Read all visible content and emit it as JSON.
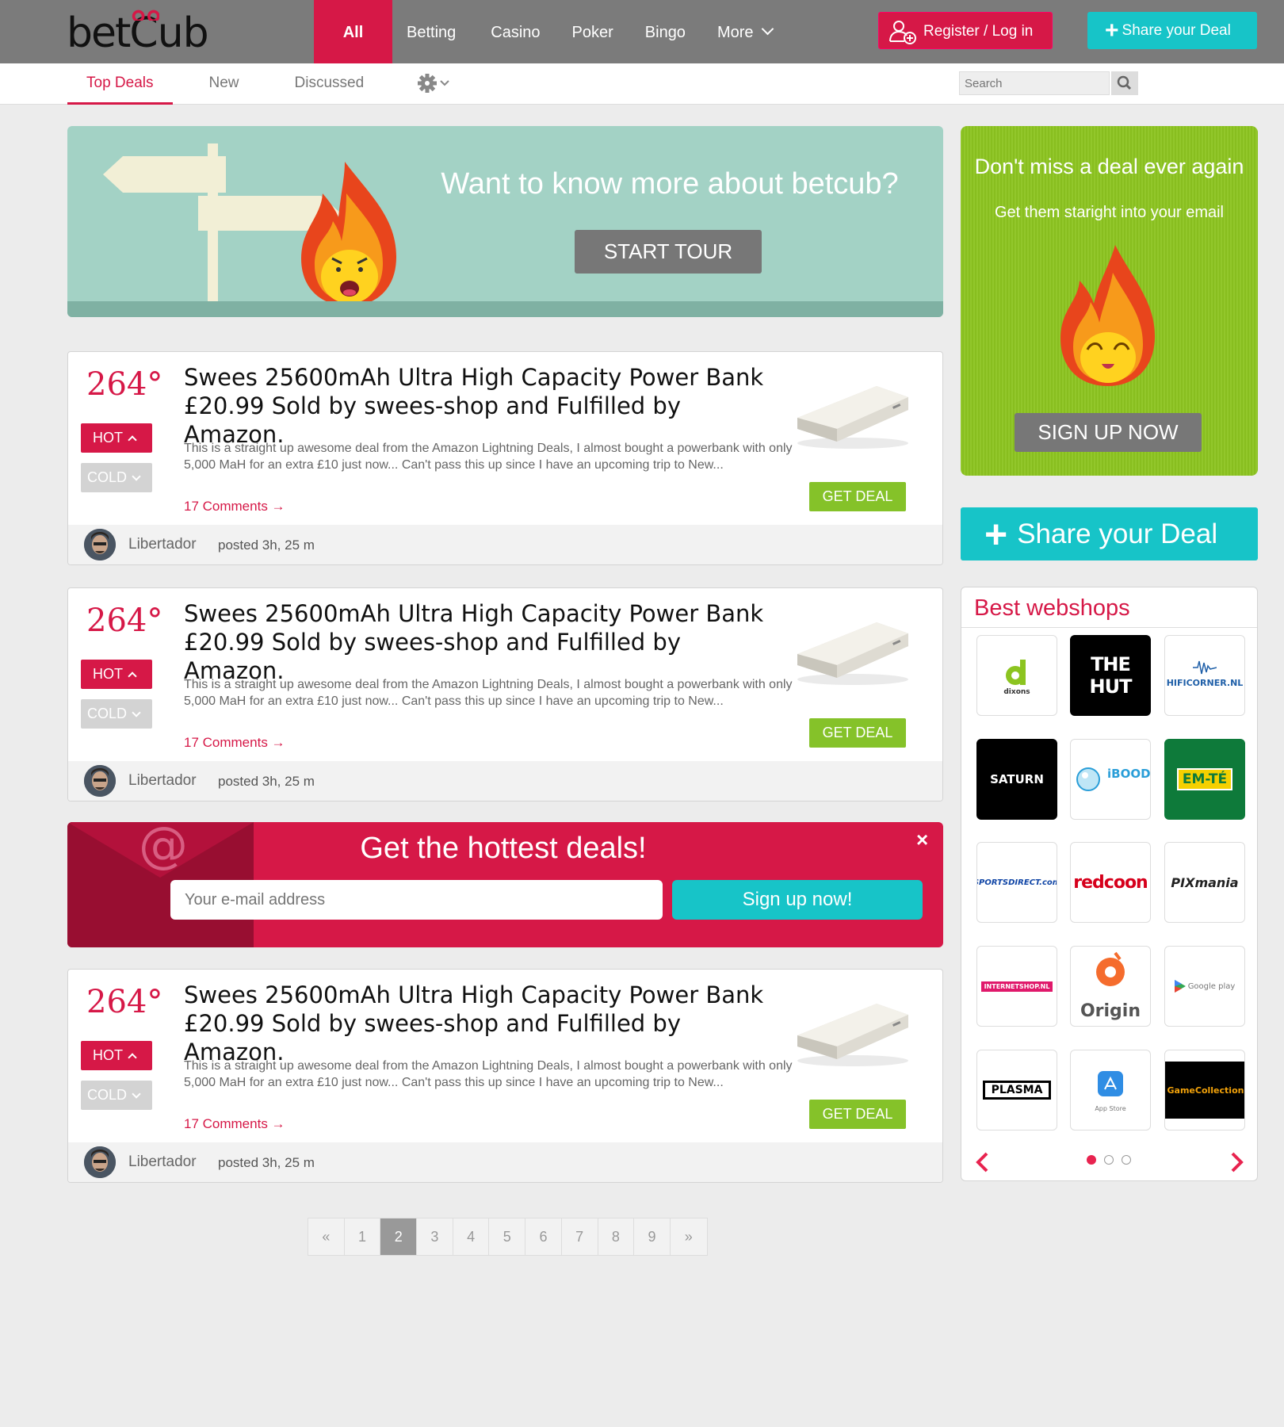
{
  "header": {
    "logo": "betcub",
    "nav": [
      {
        "label": "All",
        "active": true
      },
      {
        "label": "Betting"
      },
      {
        "label": "Casino"
      },
      {
        "label": "Poker"
      },
      {
        "label": "Bingo"
      },
      {
        "label": "More"
      }
    ],
    "register_label": "Register / Log in",
    "share_label": "Share your Deal"
  },
  "subnav": {
    "tabs": [
      {
        "label": "Top Deals",
        "active": true
      },
      {
        "label": "New"
      },
      {
        "label": "Discussed"
      }
    ],
    "search_placeholder": "Search"
  },
  "tour": {
    "heading": "Want to know more about betcub?",
    "button": "START TOUR"
  },
  "deals": [
    {
      "temperature": "264°",
      "hot": "HOT",
      "cold": "COLD",
      "title": "Swees 25600mAh Ultra High Capacity Power Bank £20.99 Sold by swees-shop and Fulfilled by Amazon.",
      "description": "This is a straight up awesome deal from the Amazon Lightning Deals, I almost bought a powerbank with only 5,000 MaH for an extra £10 just now... Can't pass this up since I have an upcoming trip to New...",
      "comments": "17 Comments →",
      "cta": "GET DEAL",
      "user": "Libertador",
      "posted": "posted 3h, 25 m"
    },
    {
      "temperature": "264°",
      "hot": "HOT",
      "cold": "COLD",
      "title": "Swees 25600mAh Ultra High Capacity Power Bank £20.99 Sold by swees-shop and Fulfilled by Amazon.",
      "description": "This is a straight up awesome deal from the Amazon Lightning Deals, I almost bought a powerbank with only 5,000 MaH for an extra £10 just now... Can't pass this up since I have an upcoming trip to New...",
      "comments": "17 Comments →",
      "cta": "GET DEAL",
      "user": "Libertador",
      "posted": "posted 3h, 25 m"
    },
    {
      "temperature": "264°",
      "hot": "HOT",
      "cold": "COLD",
      "title": "Swees 25600mAh Ultra High Capacity Power Bank £20.99 Sold by swees-shop and Fulfilled by Amazon.",
      "description": "This is a straight up awesome deal from the Amazon Lightning Deals, I almost bought a powerbank with only 5,000 MaH for an extra £10 just now... Can't pass this up since I have an upcoming trip to New...",
      "comments": "17 Comments →",
      "cta": "GET DEAL",
      "user": "Libertador",
      "posted": "posted 3h, 25 m"
    }
  ],
  "newsletter": {
    "heading": "Get the hottest deals!",
    "email_placeholder": "Your e-mail address",
    "button": "Sign up now!",
    "close": "×"
  },
  "pagination": {
    "prev": "«",
    "pages": [
      "1",
      "2",
      "3",
      "4",
      "5",
      "6",
      "7",
      "8",
      "9"
    ],
    "current": "2",
    "next": "»"
  },
  "sidebar": {
    "signup": {
      "heading": "Don't miss a deal ever again",
      "sub": "Get them staright into your email",
      "button": "SIGN UP NOW"
    },
    "share_label": "Share your Deal",
    "webshops": {
      "title": "Best webshops",
      "shops": [
        {
          "name": "dixons"
        },
        {
          "name": "THE HUT"
        },
        {
          "name": "HIFICORNER.NL"
        },
        {
          "name": "SATURN"
        },
        {
          "name": "iBOOD"
        },
        {
          "name": "EM-TÉ"
        },
        {
          "name": "SPORTSDIRECT.com"
        },
        {
          "name": "redcoon"
        },
        {
          "name": "PIXmania"
        },
        {
          "name": "INTERNETSHOP.NL"
        },
        {
          "name": "Origin"
        },
        {
          "name": "Google play"
        },
        {
          "name": "PLASMA"
        },
        {
          "name": "App Store"
        },
        {
          "name": "GameCollection"
        }
      ],
      "carousel_pages": 3,
      "carousel_active": 1
    }
  },
  "colors": {
    "brand": "#d61847",
    "teal": "#17c4c8",
    "green": "#85c229",
    "nav": "#7b7b7b"
  }
}
